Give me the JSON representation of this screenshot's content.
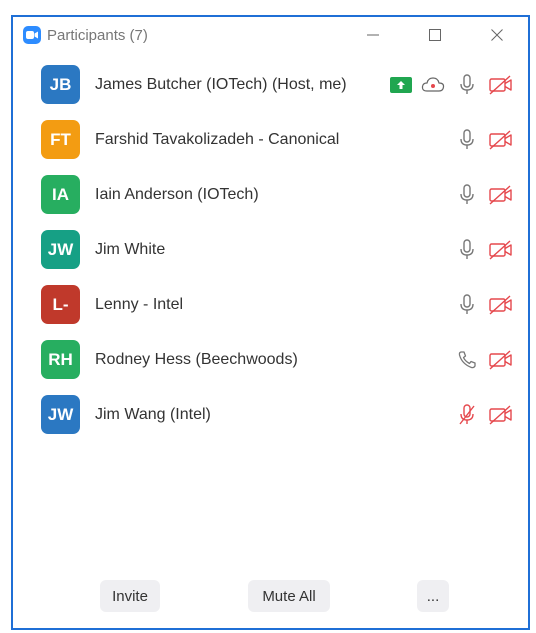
{
  "window": {
    "title": "Participants (7)"
  },
  "colors": {
    "accent": "#1f6fd6",
    "muted_red": "#e5484d",
    "share_green": "#20a650"
  },
  "participants": [
    {
      "initials": "JB",
      "name": "James Butcher (IOTech) (Host, me)",
      "avatar_color": "#2b78c2",
      "sharing": true,
      "recording": true,
      "audio": "mic",
      "video": "off"
    },
    {
      "initials": "FT",
      "name": "Farshid Tavakolizadeh - Canonical",
      "avatar_color": "#f39c12",
      "audio": "mic",
      "video": "off"
    },
    {
      "initials": "IA",
      "name": "Iain Anderson (IOTech)",
      "avatar_color": "#27ae60",
      "audio": "mic",
      "video": "off"
    },
    {
      "initials": "JW",
      "name": "Jim White",
      "avatar_color": "#16a085",
      "audio": "mic",
      "video": "off"
    },
    {
      "initials": "L-",
      "name": "Lenny - Intel",
      "avatar_color": "#c0392b",
      "audio": "mic",
      "video": "off"
    },
    {
      "initials": "RH",
      "name": "Rodney Hess (Beechwoods)",
      "avatar_color": "#27ae60",
      "audio": "phone",
      "video": "off"
    },
    {
      "initials": "JW",
      "name": "Jim Wang (Intel)",
      "avatar_color": "#2b78c2",
      "audio": "mic-muted",
      "video": "off"
    }
  ],
  "footer": {
    "invite": "Invite",
    "mute_all": "Mute All",
    "more": "..."
  }
}
